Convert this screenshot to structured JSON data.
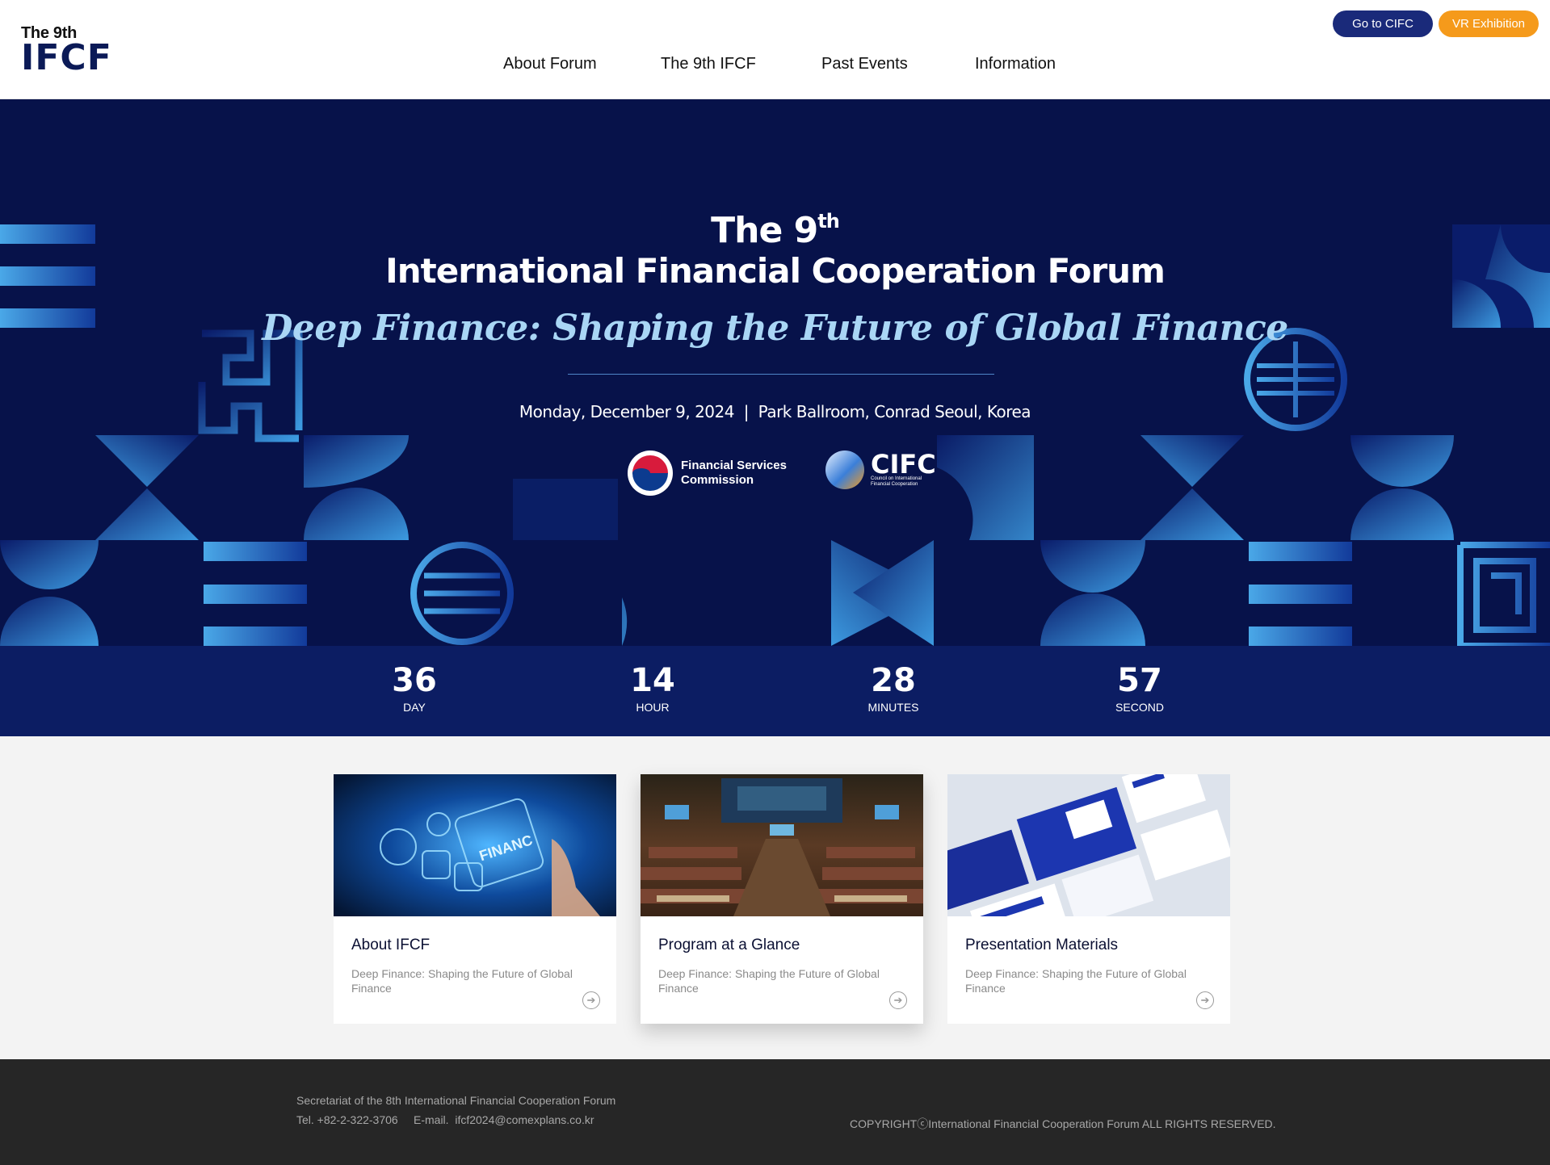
{
  "header": {
    "logo_small": "The 9th",
    "logo_big": "IFCF",
    "nav": [
      "About Forum",
      "The 9th IFCF",
      "Past Events",
      "Information"
    ],
    "go_cifc": "Go to CIFC",
    "vr_exhibition": "VR Exhibition"
  },
  "hero": {
    "title_prefix": "The 9",
    "title_sup": "th",
    "title_main": "International Financial Cooperation Forum",
    "subtitle": "Deep Finance: Shaping the Future of Global Finance",
    "date_venue": "Monday, December 9, 2024  |  Park Ballroom, Conrad Seoul, Korea",
    "fsc_line1": "Financial Services",
    "fsc_line2": "Commission",
    "cifc_name": "CIFC",
    "cifc_sub1": "Council on International",
    "cifc_sub2": "Financial Cooperation"
  },
  "countdown": [
    {
      "value": "36",
      "label": "DAY"
    },
    {
      "value": "14",
      "label": "HOUR"
    },
    {
      "value": "28",
      "label": "MINUTES"
    },
    {
      "value": "57",
      "label": "SECOND"
    }
  ],
  "cards": [
    {
      "title": "About IFCF",
      "desc": "Deep Finance: Shaping the Future of Global Finance",
      "image": "finance-tech-image"
    },
    {
      "title": "Program at a Glance",
      "desc": "Deep Finance: Shaping the Future of Global Finance",
      "image": "conference-hall-image"
    },
    {
      "title": "Presentation Materials",
      "desc": "Deep Finance: Shaping the Future of Global Finance",
      "image": "slides-mockup-image"
    }
  ],
  "footer": {
    "secretariat": "Secretariat of the 8th International Financial Cooperation Forum",
    "tel": "Tel. +82-2-322-3706",
    "email": "E-mail.  ifcf2024@comexplans.co.kr",
    "copyright": "COPYRIGHTⓒInternational Financial Cooperation Forum ALL RIGHTS RESERVED."
  },
  "colors": {
    "hero_bg": "#07124a",
    "countdown_bg": "#0c1d63",
    "accent_orange": "#f59a1b",
    "button_navy": "#1a2a7a",
    "subtitle_blue": "#a9d6f5",
    "footer_bg": "#262626"
  }
}
